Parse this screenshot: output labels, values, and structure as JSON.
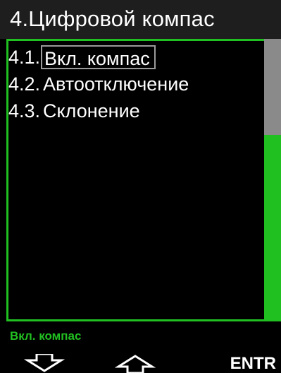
{
  "header": {
    "title": "4.Цифровой компас"
  },
  "menu": {
    "items": [
      {
        "number": "4.1.",
        "label": "Вкл. компас",
        "selected": true
      },
      {
        "number": "4.2.",
        "label": "Автоотключение",
        "selected": false
      },
      {
        "number": "4.3.",
        "label": "Склонение",
        "selected": false
      }
    ]
  },
  "scrollbar": {
    "thumb_fraction": 0.34
  },
  "status": {
    "text": "Вкл. компас"
  },
  "softkeys": {
    "left_icon": "arrow-down-icon",
    "middle_icon": "arrow-up-icon",
    "right_label": "ENTR"
  },
  "colors": {
    "accent_green": "#21c021",
    "background": "#000000",
    "titlebar": "#1e1e1e",
    "scroll_thumb": "#8a8a8a",
    "selection_border": "#9a9a9a"
  }
}
